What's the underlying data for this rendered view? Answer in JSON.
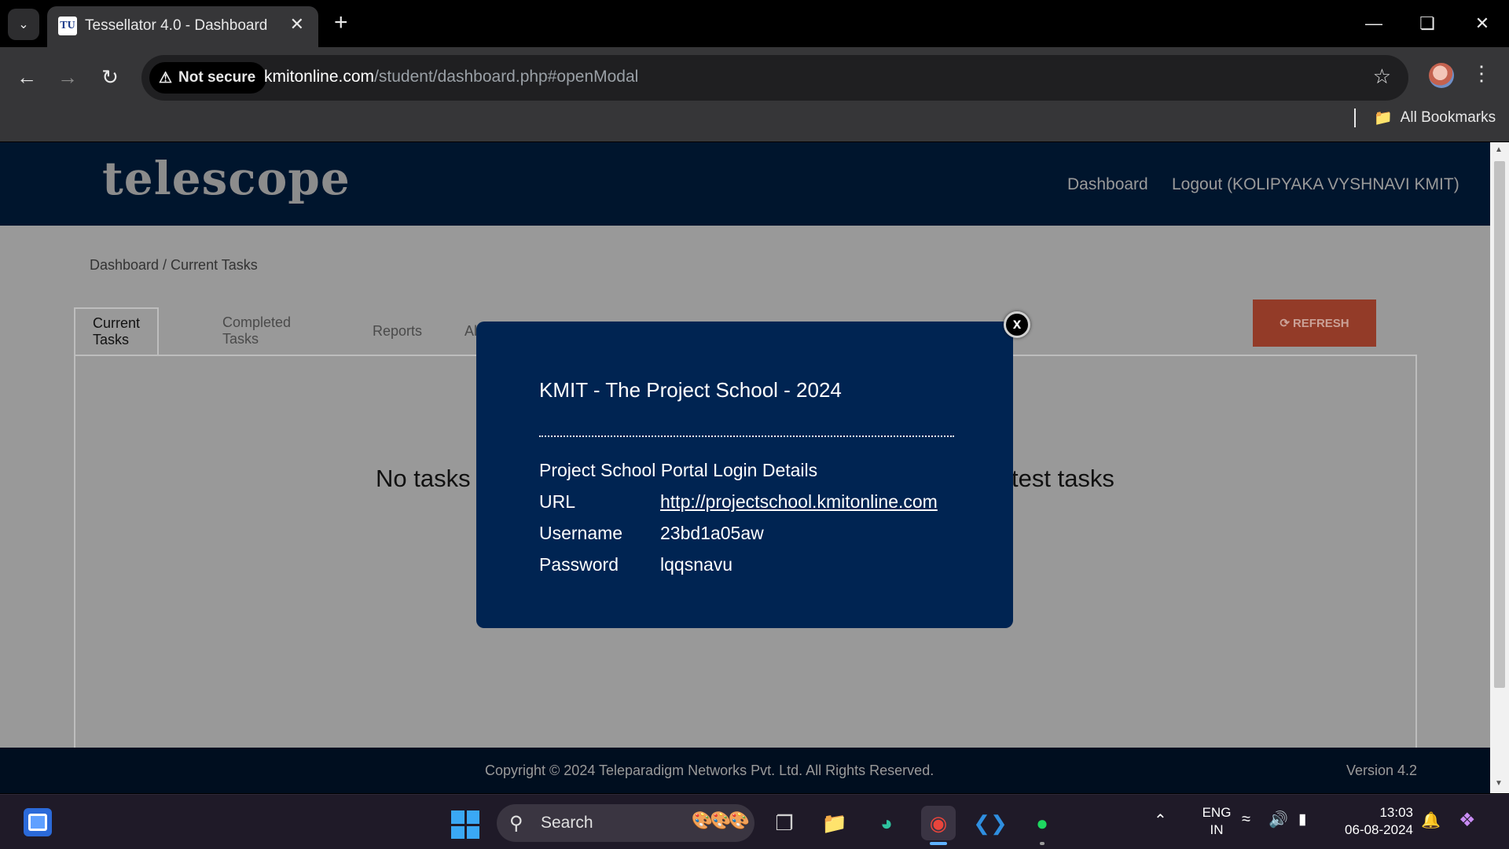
{
  "browser": {
    "tab_title": "Tessellator 4.0 - Dashboard",
    "tab_favicon_text": "TU",
    "security_label": "Not secure",
    "url_host": "kmitonline.com",
    "url_path": "/student/dashboard.php#openModal",
    "bookmarks_label": "All Bookmarks"
  },
  "site": {
    "logo": "telescope",
    "nav": {
      "dashboard": "Dashboard",
      "logout": "Logout (KOLIPYAKA VYSHNAVI KMIT)"
    },
    "breadcrumb": "Dashboard / Current Tasks",
    "tabs": [
      {
        "label": "Current Tasks",
        "active": true
      },
      {
        "label": "Completed Tasks",
        "active": false
      },
      {
        "label": "Reports",
        "active": false
      },
      {
        "label": "Al",
        "active": false
      }
    ],
    "refresh_label": "REFRESH",
    "empty_message_left": "No tasks",
    "empty_message_right": "test tasks",
    "footer": {
      "copyright": "Copyright © 2024 Teleparadigm Networks Pvt. Ltd. All Rights Reserved.",
      "version": "Version 4.2"
    }
  },
  "modal": {
    "close_label": "x",
    "title": "KMIT - The Project School - 2024",
    "subtitle": "Project School Portal Login Details",
    "rows": [
      {
        "key": "URL",
        "value": "http://projectschool.kmitonline.com"
      },
      {
        "key": "Username",
        "value": "23bd1a05aw"
      },
      {
        "key": "Password",
        "value": "lqqsnavu"
      }
    ]
  },
  "taskbar": {
    "search_label": "Search",
    "language": "ENG",
    "region": "IN",
    "time": "13:03",
    "date": "06-08-2024"
  },
  "colors": {
    "nav_bg": "#00152d",
    "modal_bg": "#002452",
    "refresh_bg": "#933b28",
    "page_overlay": "#999999"
  }
}
